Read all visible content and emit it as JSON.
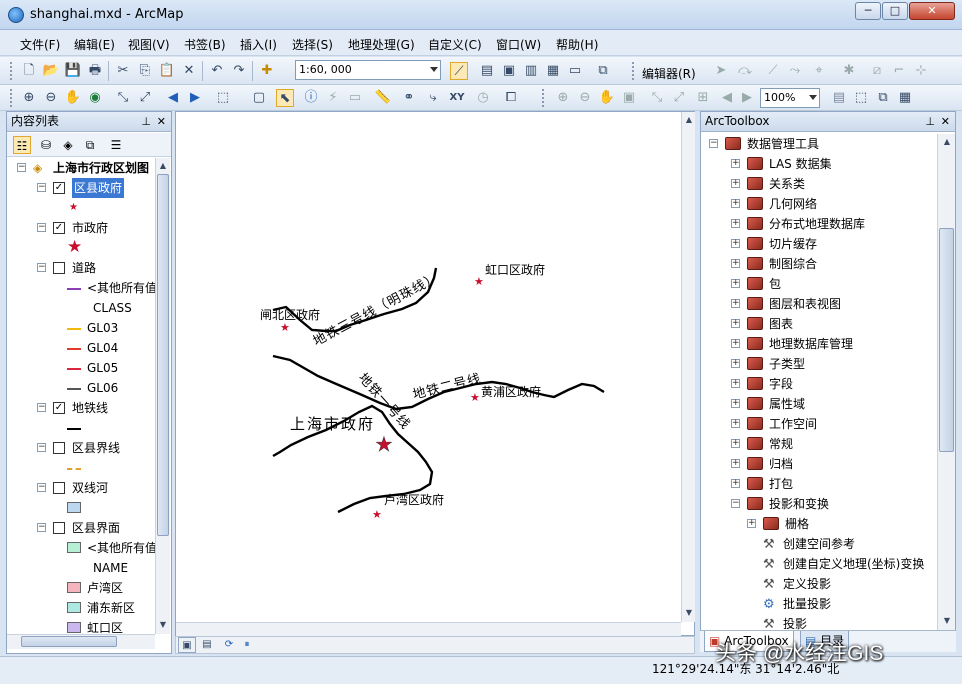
{
  "window": {
    "title": "shanghai.mxd - ArcMap",
    "min": "0",
    "max": "1",
    "close": "r"
  },
  "menu": [
    "文件(F)",
    "编辑(E)",
    "视图(V)",
    "书签(B)",
    "插入(I)",
    "选择(S)",
    "地理处理(G)",
    "自定义(C)",
    "窗口(W)",
    "帮助(H)"
  ],
  "toolbar": {
    "scale": "1:60, 000",
    "editor": "编辑器(R)",
    "zoom": "100%"
  },
  "toc": {
    "title": "内容列表",
    "rows": [
      {
        "level": 0,
        "type": "frame",
        "label": "上海市行政区划图",
        "expanded": true
      },
      {
        "level": 1,
        "type": "layer",
        "label": "区县政府",
        "checked": true,
        "selected": true
      },
      {
        "level": 2,
        "type": "sym-star-small",
        "label": ""
      },
      {
        "level": 1,
        "type": "layer",
        "label": "市政府",
        "checked": true
      },
      {
        "level": 2,
        "type": "sym-star-big",
        "label": ""
      },
      {
        "level": 1,
        "type": "layer",
        "label": "道路",
        "checked": false
      },
      {
        "level": 2,
        "type": "sym-line",
        "label": "<其他所有值>",
        "color": "#8b3fb5"
      },
      {
        "level": 2,
        "type": "heading",
        "label": "CLASS"
      },
      {
        "level": 2,
        "type": "sym-line",
        "label": "GL03",
        "color": "#f2b80c"
      },
      {
        "level": 2,
        "type": "sym-line",
        "label": "GL04",
        "color": "#e23a2c"
      },
      {
        "level": 2,
        "type": "sym-line",
        "label": "GL05",
        "color": "#d8273f"
      },
      {
        "level": 2,
        "type": "sym-line",
        "label": "GL06",
        "color": "#555555"
      },
      {
        "level": 1,
        "type": "layer",
        "label": "地铁线",
        "checked": true
      },
      {
        "level": 2,
        "type": "sym-line",
        "label": "",
        "color": "#000000"
      },
      {
        "level": 1,
        "type": "layer",
        "label": "区县界线",
        "checked": false
      },
      {
        "level": 2,
        "type": "sym-line-dash",
        "label": "",
        "color": "#e0a030"
      },
      {
        "level": 1,
        "type": "layer",
        "label": "双线河",
        "checked": false
      },
      {
        "level": 2,
        "type": "sym-patch",
        "label": "",
        "color": "#bdd7ee"
      },
      {
        "level": 1,
        "type": "layer",
        "label": "区县界面",
        "checked": false
      },
      {
        "level": 2,
        "type": "sym-patch",
        "label": "<其他所有值>",
        "color": "#b7eed6"
      },
      {
        "level": 2,
        "type": "heading",
        "label": "NAME"
      },
      {
        "level": 2,
        "type": "sym-patch",
        "label": "卢湾区",
        "color": "#f6b4bc"
      },
      {
        "level": 2,
        "type": "sym-patch",
        "label": "浦东新区",
        "color": "#aee9e1"
      },
      {
        "level": 2,
        "type": "sym-patch",
        "label": "虹口区",
        "color": "#c9b7ee"
      }
    ]
  },
  "map": {
    "labels": {
      "hongkou": "虹口区政府",
      "zhabei": "闸北区政府",
      "huangpu": "黄浦区政府",
      "luwan": "卢湾区政府",
      "city": "上海市政府",
      "line3": "地铁三号线（明珠线）",
      "line2": "地铁二号线",
      "line1": "地铁一号线"
    }
  },
  "toolbox": {
    "title": "ArcToolbox",
    "rows": [
      {
        "level": 0,
        "type": "box",
        "label": "数据管理工具",
        "expanded": true
      },
      {
        "level": 1,
        "type": "box",
        "label": "LAS 数据集"
      },
      {
        "level": 1,
        "type": "box",
        "label": "关系类"
      },
      {
        "level": 1,
        "type": "box",
        "label": "几何网络"
      },
      {
        "level": 1,
        "type": "box",
        "label": "分布式地理数据库"
      },
      {
        "level": 1,
        "type": "box",
        "label": "切片缓存"
      },
      {
        "level": 1,
        "type": "box",
        "label": "制图综合"
      },
      {
        "level": 1,
        "type": "box",
        "label": "包"
      },
      {
        "level": 1,
        "type": "box",
        "label": "图层和表视图"
      },
      {
        "level": 1,
        "type": "box",
        "label": "图表"
      },
      {
        "level": 1,
        "type": "box",
        "label": "地理数据库管理"
      },
      {
        "level": 1,
        "type": "box",
        "label": "子类型"
      },
      {
        "level": 1,
        "type": "box",
        "label": "字段"
      },
      {
        "level": 1,
        "type": "box",
        "label": "属性域"
      },
      {
        "level": 1,
        "type": "box",
        "label": "工作空间"
      },
      {
        "level": 1,
        "type": "box",
        "label": "常规"
      },
      {
        "level": 1,
        "type": "box",
        "label": "归档"
      },
      {
        "level": 1,
        "type": "box",
        "label": "打包"
      },
      {
        "level": 1,
        "type": "box",
        "label": "投影和变换",
        "expanded": true
      },
      {
        "level": 2,
        "type": "box",
        "label": "栅格"
      },
      {
        "level": 2,
        "type": "tool",
        "label": "创建空间参考"
      },
      {
        "level": 2,
        "type": "tool",
        "label": "创建自定义地理(坐标)变换"
      },
      {
        "level": 2,
        "type": "tool",
        "label": "定义投影"
      },
      {
        "level": 2,
        "type": "script",
        "label": "批量投影"
      },
      {
        "level": 2,
        "type": "tool",
        "label": "投影"
      }
    ],
    "tabs": [
      "ArcToolbox",
      "目录"
    ]
  },
  "status": {
    "coords": "121°29'24.14\"东  31°14'2.46\"北"
  },
  "watermark": "头条 @水经注GIS"
}
